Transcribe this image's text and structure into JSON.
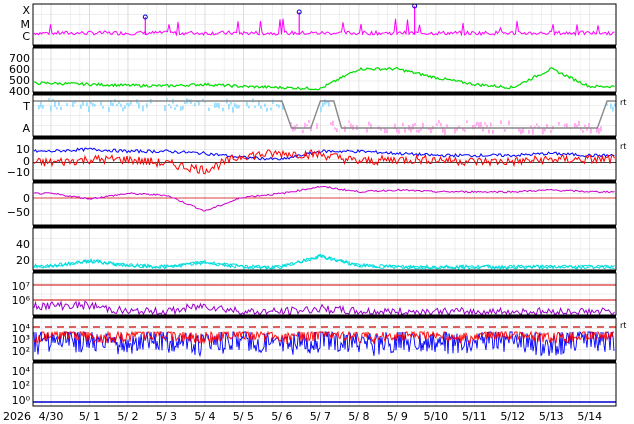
{
  "chart_data": {
    "type": "line",
    "date_axis": {
      "year_label": "2026",
      "tick_labels": [
        "4/30",
        "5/ 1",
        "5/ 2",
        "5/ 3",
        "5/ 4",
        "5/ 5",
        "5/ 6",
        "5/ 7",
        "5/ 8",
        "5/ 9",
        "5/10",
        "5/11",
        "5/12",
        "5/13",
        "5/14"
      ]
    },
    "panels": [
      {
        "id": "xray",
        "ylabels": [
          "X",
          "M",
          "C"
        ],
        "series": [
          {
            "color": "#ff00ff",
            "peak_days": [
              "5/3",
              "5/6",
              "5/9"
            ]
          }
        ]
      },
      {
        "id": "speed",
        "ylabels": [
          "700",
          "600",
          "500",
          "400"
        ],
        "ylim": [
          350,
          750
        ],
        "series": [
          {
            "color": "#00dd00",
            "values": [
              430,
              420,
              410,
              405,
              420,
              400,
              390,
              380,
              560,
              560,
              480,
              420,
              390,
              560,
              400
            ]
          }
        ]
      },
      {
        "id": "sector",
        "ylabels": [
          "T",
          "A"
        ],
        "right_mark": "rt",
        "series": [
          {
            "color": "#99ddff",
            "name": "T"
          },
          {
            "color": "#ffaaee",
            "name": "A"
          },
          {
            "color": "#888888",
            "transitions": [
              "5/5",
              "5/6",
              "5/14"
            ]
          }
        ]
      },
      {
        "id": "imf",
        "ylabels": [
          "10",
          "0",
          "−10"
        ],
        "ylim": [
          -20,
          20
        ],
        "right_mark": "rt",
        "series": [
          {
            "color": "#0000ff",
            "values": [
              8,
              10,
              8,
              8,
              6,
              2,
              0,
              8,
              8,
              6,
              4,
              4,
              4,
              6,
              4
            ]
          },
          {
            "color": "#ff0000",
            "values": [
              -3,
              0,
              0,
              -4,
              -10,
              4,
              6,
              5,
              -2,
              0,
              0,
              -2,
              -2,
              0,
              0
            ]
          }
        ]
      },
      {
        "id": "dst",
        "ylabels": [
          "0",
          "−50"
        ],
        "ylim": [
          -100,
          20
        ],
        "series": [
          {
            "color": "#cc00cc",
            "values": [
              -10,
              -25,
              -10,
              -15,
              -60,
              -20,
              -10,
              10,
              -5,
              0,
              -5,
              -5,
              -5,
              0,
              -5
            ]
          }
        ]
      },
      {
        "id": "kp",
        "ylabels": [
          "40",
          "20"
        ],
        "ylim": [
          0,
          55
        ],
        "series": [
          {
            "color": "#00dddd",
            "values": [
              5,
              12,
              6,
              4,
              10,
              4,
              4,
              18,
              6,
              4,
              4,
              4,
              4,
              4,
              4
            ]
          }
        ]
      },
      {
        "id": "proton",
        "ylabels": [
          "10⁷",
          "10⁶"
        ],
        "series": [
          {
            "color": "#9900cc",
            "values": [
              3,
              3,
              1,
              1,
              3,
              1,
              1,
              2,
              1,
              1,
              1,
              1,
              1,
              1,
              1
            ]
          }
        ]
      },
      {
        "id": "electron",
        "ylabels": [
          "10⁴",
          "10³",
          "10²"
        ],
        "right_mark": "rt",
        "series": [
          {
            "color": "#ff0000"
          },
          {
            "color": "#0000ff"
          }
        ]
      },
      {
        "id": "neutron",
        "ylabels": [
          "10⁴",
          "10²",
          "10⁰"
        ],
        "series": [
          {
            "color": "#0000cc"
          }
        ]
      }
    ]
  }
}
